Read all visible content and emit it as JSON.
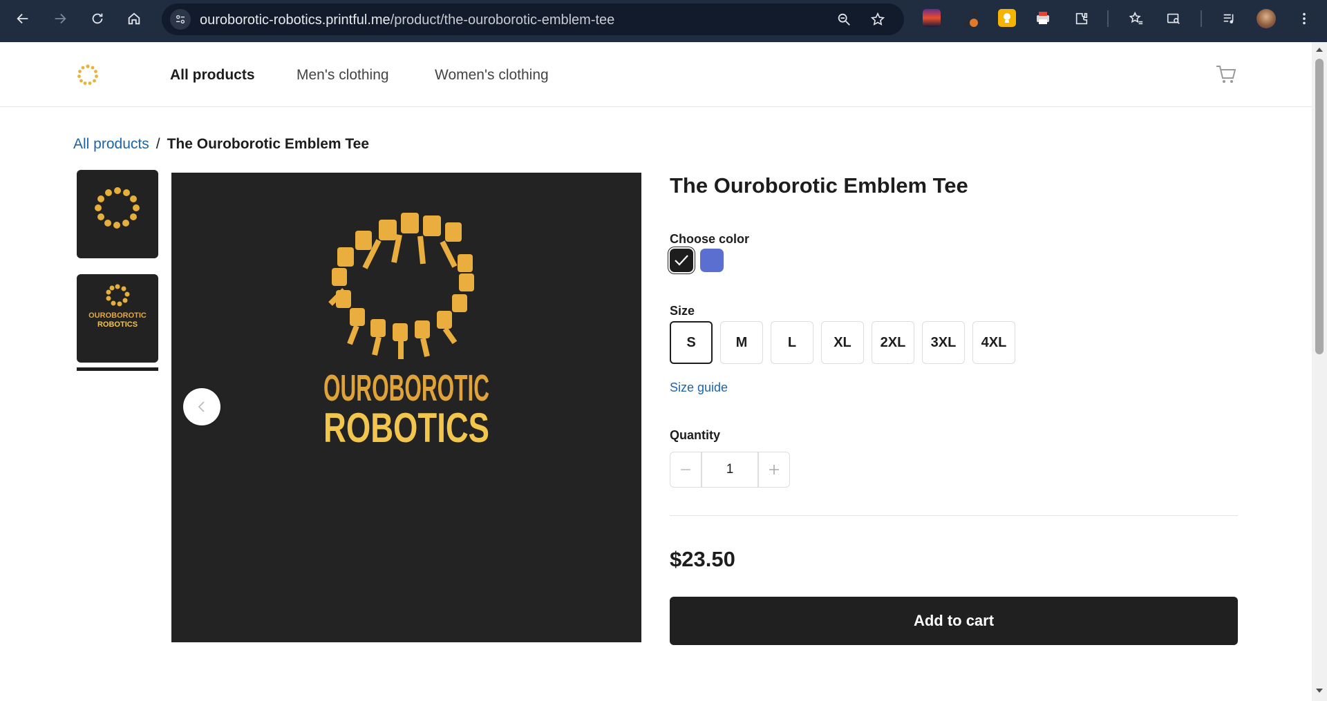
{
  "browser": {
    "url_host": "ouroborotic-robotics.printful.me",
    "url_path": "/product/the-ouroborotic-emblem-tee"
  },
  "header": {
    "nav": [
      {
        "label": "All products",
        "active": true
      },
      {
        "label": "Men's clothing",
        "active": false
      },
      {
        "label": "Women's clothing",
        "active": false
      }
    ]
  },
  "breadcrumb": {
    "parent": "All products",
    "separator": "/",
    "current": "The Ouroborotic Emblem Tee"
  },
  "gallery": {
    "logo_line1": "OUROBOROTIC",
    "logo_line2": "ROBOTICS",
    "selected_thumbnail": 2
  },
  "product": {
    "title": "The Ouroborotic Emblem Tee",
    "color_label": "Choose color",
    "colors": [
      {
        "name": "black",
        "hex": "#1d1d1d",
        "selected": true
      },
      {
        "name": "blue",
        "hex": "#5b6fd0",
        "selected": false
      }
    ],
    "size_label": "Size",
    "sizes": [
      "S",
      "M",
      "L",
      "XL",
      "2XL",
      "3XL",
      "4XL"
    ],
    "selected_size": "S",
    "size_guide": "Size guide",
    "quantity_label": "Quantity",
    "quantity": "1",
    "price": "$23.50",
    "add_to_cart": "Add to cart"
  }
}
